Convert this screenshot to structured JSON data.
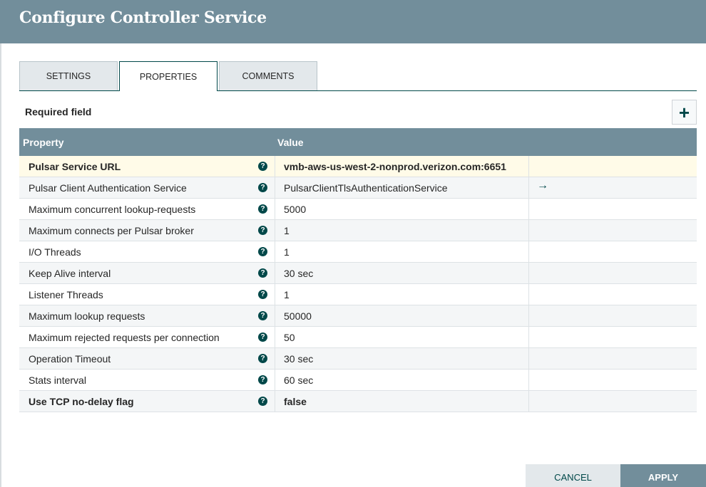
{
  "dialog": {
    "title": "Configure Controller Service"
  },
  "tabs": [
    {
      "label": "SETTINGS"
    },
    {
      "label": "PROPERTIES"
    },
    {
      "label": "COMMENTS"
    }
  ],
  "required_label": "Required field",
  "add_button": {
    "label": "+"
  },
  "table": {
    "headers": {
      "property": "Property",
      "value": "Value"
    },
    "help_glyph": "?",
    "goto_glyph": "→",
    "rows": [
      {
        "name": "Pulsar Service URL",
        "value": "vmb-aws-us-west-2-nonprod.verizon.com:6651"
      },
      {
        "name": "Pulsar Client Authentication Service",
        "value": "PulsarClientTlsAuthenticationService"
      },
      {
        "name": "Maximum concurrent lookup-requests",
        "value": "5000"
      },
      {
        "name": "Maximum connects per Pulsar broker",
        "value": "1"
      },
      {
        "name": "I/O Threads",
        "value": "1"
      },
      {
        "name": "Keep Alive interval",
        "value": "30 sec"
      },
      {
        "name": "Listener Threads",
        "value": "1"
      },
      {
        "name": "Maximum lookup requests",
        "value": "50000"
      },
      {
        "name": "Maximum rejected requests per connection",
        "value": "50"
      },
      {
        "name": "Operation Timeout",
        "value": "30 sec"
      },
      {
        "name": "Stats interval",
        "value": "60 sec"
      },
      {
        "name": "Use TCP no-delay flag",
        "value": "false"
      }
    ]
  },
  "buttons": {
    "cancel": "CANCEL",
    "apply": "APPLY"
  },
  "colors": {
    "header": "#728e9b",
    "accent": "#004849",
    "highlight_row": "#fffbe8"
  }
}
